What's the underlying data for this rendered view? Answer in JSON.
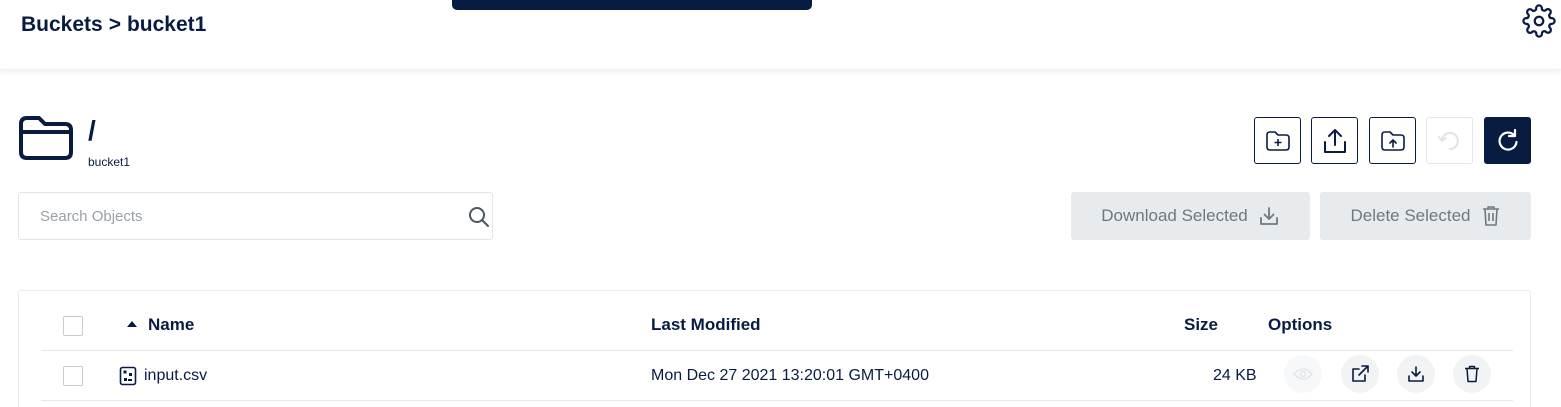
{
  "header": {
    "breadcrumb": {
      "root": "Buckets",
      "separator": ">",
      "current": "bucket1"
    },
    "settings_icon": "gear-icon"
  },
  "location": {
    "path": "/",
    "bucket": "bucket1",
    "icon": "folder-icon"
  },
  "toolbar": {
    "buttons": [
      {
        "icon": "folder-plus-icon",
        "enabled": true
      },
      {
        "icon": "upload-icon",
        "enabled": true
      },
      {
        "icon": "folder-upload-icon",
        "enabled": true
      },
      {
        "icon": "rewind-icon",
        "enabled": false
      },
      {
        "icon": "refresh-icon",
        "enabled": true,
        "primary": true
      }
    ]
  },
  "search": {
    "placeholder": "Search Objects",
    "value": "",
    "icon": "search-icon"
  },
  "actions": {
    "download_label": "Download Selected",
    "download_icon": "download-icon",
    "delete_label": "Delete Selected",
    "delete_icon": "trash-icon"
  },
  "table": {
    "columns": {
      "name": "Name",
      "modified": "Last Modified",
      "size": "Size",
      "options": "Options"
    },
    "sort": {
      "column": "Name",
      "direction": "ascending"
    },
    "rows": [
      {
        "name": "input.csv",
        "file_icon": "file-icon",
        "modified": "Mon Dec 27 2021 13:20:01 GMT+0400",
        "size": "24 KB",
        "options": [
          "preview-icon",
          "share-icon",
          "download-icon",
          "trash-icon"
        ]
      }
    ]
  },
  "colors": {
    "primary": "#081c42",
    "disabled_bg": "#e8ebed",
    "disabled_text": "#6f7880",
    "border": "#e3e6e9"
  }
}
